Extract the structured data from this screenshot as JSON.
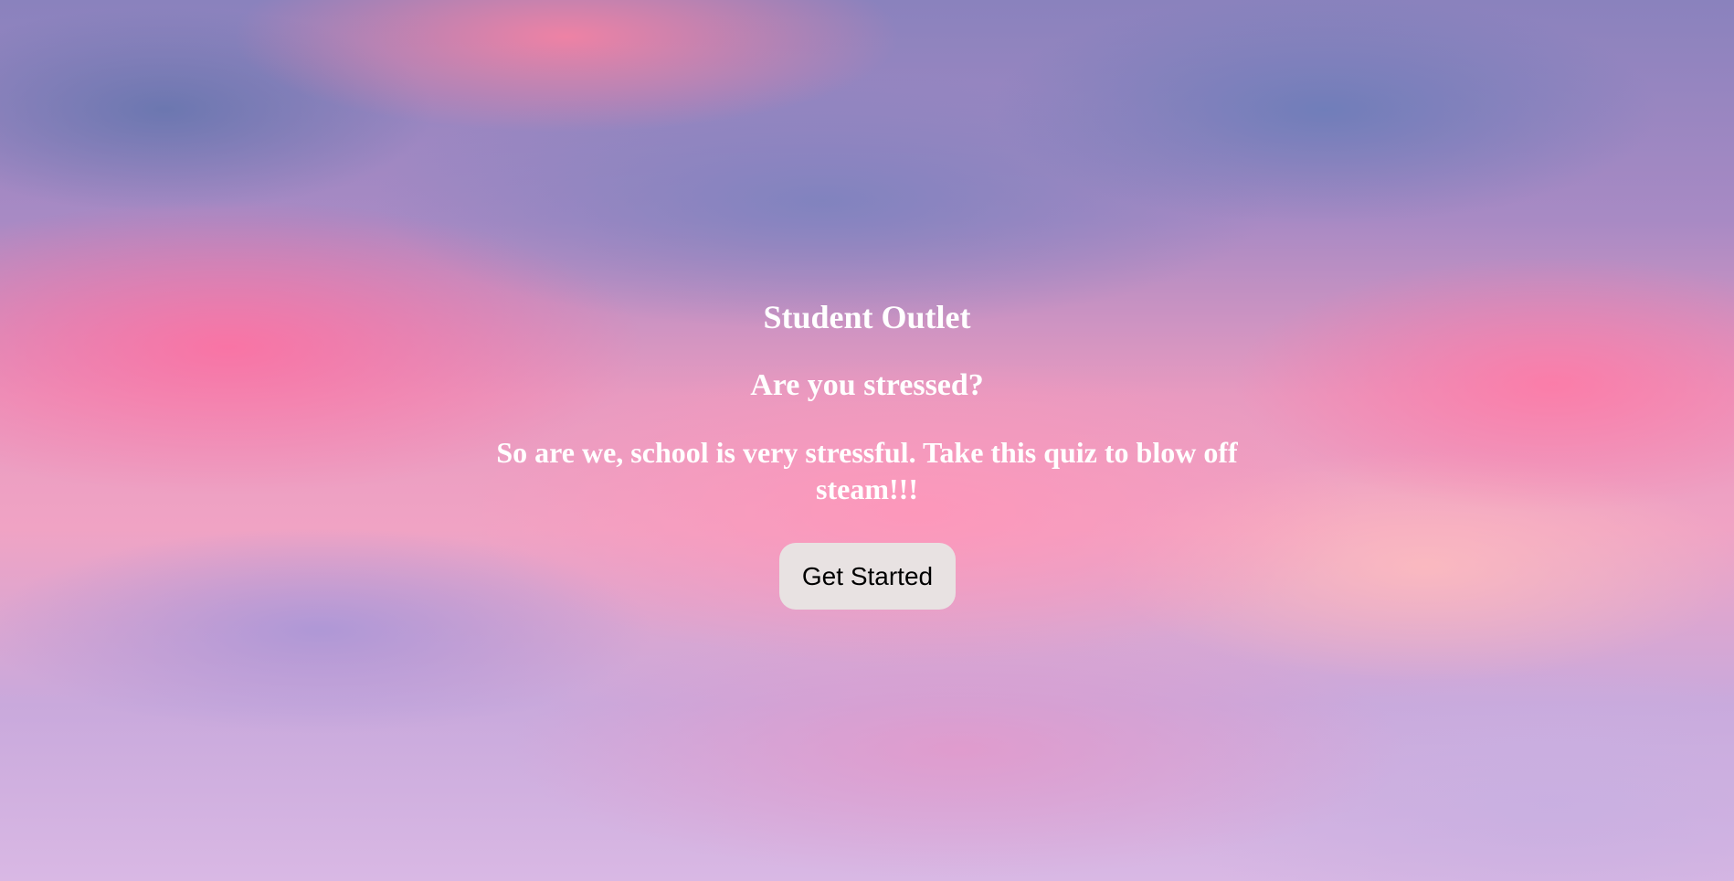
{
  "page": {
    "title": "Student Outlet",
    "subtitle": "Are you stressed?",
    "message": "So are we, school is very stressful. Take this quiz to blow off steam!!!",
    "cta_label": "Get Started"
  },
  "colors": {
    "text": "#ffffff",
    "button_bg": "#e8e2e2",
    "button_text": "#000000",
    "sky_pink": "#f0a3c4",
    "sky_purple": "#8a82bd"
  }
}
